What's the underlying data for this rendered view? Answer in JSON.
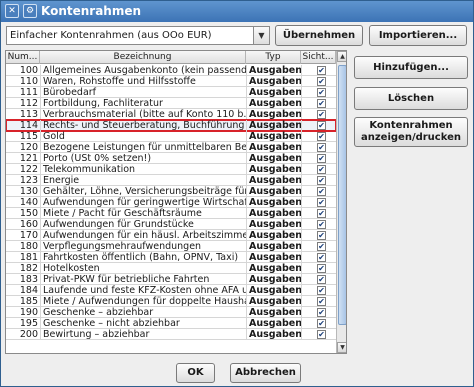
{
  "window": {
    "title": "Kontenrahmen"
  },
  "toolbar": {
    "chart_select": "Einfacher Kontenrahmen (aus OOo EUR)",
    "apply_label": "Übernehmen",
    "import_label": "Importieren..."
  },
  "table": {
    "columns": [
      "Num...",
      "Bezeichnung",
      "Typ",
      "Sicht..."
    ],
    "selected_index": 5,
    "scroll_fraction_visible": 0.95,
    "rows": [
      {
        "num": "100",
        "desc": "Allgemeines Ausgabenkonto (kein passend...",
        "typ": "Ausgaben",
        "visible": true
      },
      {
        "num": "110",
        "desc": "Waren, Rohstoffe und Hilfsstoffe",
        "typ": "Ausgaben",
        "visible": true
      },
      {
        "num": "111",
        "desc": "Bürobedarf",
        "typ": "Ausgaben",
        "visible": true
      },
      {
        "num": "112",
        "desc": "Fortbildung, Fachliteratur",
        "typ": "Ausgaben",
        "visible": true
      },
      {
        "num": "113",
        "desc": "Verbrauchsmaterial (bitte auf Konto 110 b...",
        "typ": "Ausgaben",
        "visible": true
      },
      {
        "num": "114",
        "desc": "Rechts- und Steuerberatung, Buchführung",
        "typ": "Ausgaben",
        "visible": true
      },
      {
        "num": "115",
        "desc": "Gold",
        "typ": "Ausgaben",
        "visible": true
      },
      {
        "num": "120",
        "desc": "Bezogene Leistungen für unmittelbaren Bet...",
        "typ": "Ausgaben",
        "visible": true
      },
      {
        "num": "121",
        "desc": "Porto (USt 0% setzen!)",
        "typ": "Ausgaben",
        "visible": true
      },
      {
        "num": "122",
        "desc": "Telekommunikation",
        "typ": "Ausgaben",
        "visible": true
      },
      {
        "num": "123",
        "desc": "Energie",
        "typ": "Ausgaben",
        "visible": true
      },
      {
        "num": "130",
        "desc": "Gehälter, Löhne, Versicherungsbeiträge für...",
        "typ": "Ausgaben",
        "visible": true
      },
      {
        "num": "140",
        "desc": "Aufwendungen für geringwertige Wirtschaft...",
        "typ": "Ausgaben",
        "visible": true
      },
      {
        "num": "150",
        "desc": "Miete / Pacht für Geschäftsräume",
        "typ": "Ausgaben",
        "visible": true
      },
      {
        "num": "160",
        "desc": "Aufwendungen für Grundstücke",
        "typ": "Ausgaben",
        "visible": true
      },
      {
        "num": "170",
        "desc": "Aufwendungen für ein häusl. Arbeitszimmer",
        "typ": "Ausgaben",
        "visible": true
      },
      {
        "num": "180",
        "desc": "Verpflegungsmehraufwendungen",
        "typ": "Ausgaben",
        "visible": true
      },
      {
        "num": "181",
        "desc": "Fahrtkosten öffentlich (Bahn, ÖPNV, Taxi)",
        "typ": "Ausgaben",
        "visible": true
      },
      {
        "num": "182",
        "desc": "Hotelkosten",
        "typ": "Ausgaben",
        "visible": true
      },
      {
        "num": "183",
        "desc": "Privat-PKW für betriebliche Fahrten",
        "typ": "Ausgaben",
        "visible": true
      },
      {
        "num": "184",
        "desc": "Laufende und feste KFZ-Kosten ohne AFA u...",
        "typ": "Ausgaben",
        "visible": true
      },
      {
        "num": "185",
        "desc": "Miete / Aufwendungen für doppelte Hausha...",
        "typ": "Ausgaben",
        "visible": true
      },
      {
        "num": "190",
        "desc": "Geschenke – abziehbar",
        "typ": "Ausgaben",
        "visible": true
      },
      {
        "num": "195",
        "desc": "Geschenke – nicht abziehbar",
        "typ": "Ausgaben",
        "visible": true
      },
      {
        "num": "200",
        "desc": "Bewirtung – abziehbar",
        "typ": "Ausgaben",
        "visible": true
      }
    ]
  },
  "side_buttons": {
    "add": "Hinzufügen...",
    "delete": "Löschen",
    "show_print": "Kontenrahmen anzeigen/drucken"
  },
  "footer": {
    "ok": "OK",
    "cancel": "Abbrechen"
  },
  "colors": {
    "titlebar": "#4a7fbd",
    "selection_outline": "#d8232a"
  },
  "icons": {
    "app": "app-menu-icon",
    "info": "info-icon",
    "dropdown": "chevron-down-icon",
    "check": "checkmark-icon"
  }
}
